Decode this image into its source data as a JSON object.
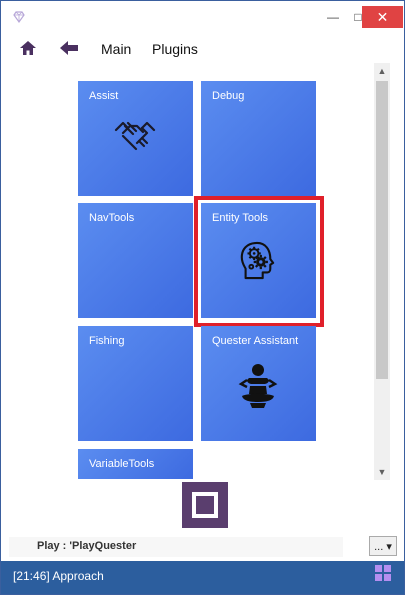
{
  "window": {
    "controls": {
      "minimize": "—",
      "maximize": "□",
      "close": "✕"
    }
  },
  "nav": {
    "home_icon": "home-icon",
    "back_icon": "back-arrow-icon",
    "main_label": "Main",
    "plugins_label": "Plugins"
  },
  "tiles": [
    {
      "label": "Assist",
      "icon": "handshake-icon"
    },
    {
      "label": "Debug",
      "icon": ""
    },
    {
      "label": "NavTools",
      "icon": ""
    },
    {
      "label": "Entity Tools",
      "icon": "head-gears-icon",
      "selected": true
    },
    {
      "label": "Fishing",
      "icon": ""
    },
    {
      "label": "Quester Assistant",
      "icon": "meditating-person-icon"
    },
    {
      "label": "VariableTools",
      "icon": ""
    }
  ],
  "scrollbar": {
    "up": "▲",
    "down": "▼"
  },
  "status": {
    "play_text": "Play : 'PlayQuester",
    "dropdown_label": "... ▾"
  },
  "bottom": {
    "log_text": "[21:46] Approach"
  },
  "colors": {
    "tile_blue": "#4a79e8",
    "selected_border": "#e0202a",
    "stop_purple": "#5a3e6e",
    "status_bar": "#2c5e9e",
    "grid_icon": "#b48ef0"
  }
}
